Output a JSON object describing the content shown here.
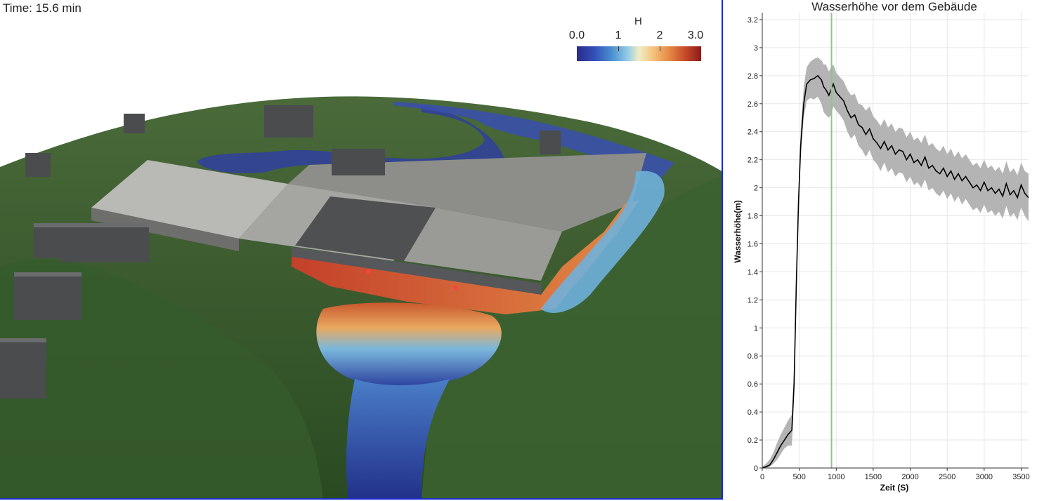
{
  "view": {
    "time_label": "Time: 15.6 min",
    "colorbar": {
      "title": "H",
      "ticks": [
        "0.0",
        "1",
        "2",
        "3.0"
      ],
      "range": [
        0.0,
        3.0
      ]
    }
  },
  "chart_data": {
    "type": "line",
    "title": "Wasserhöhe vor dem Gebäude",
    "xlabel": "Zeit (S)",
    "ylabel": "Wasserhöhe(m)",
    "xlim": [
      0,
      3600
    ],
    "ylim": [
      0,
      3.25
    ],
    "xticks": [
      0,
      500,
      1000,
      1500,
      2000,
      2500,
      3000,
      3500
    ],
    "yticks": [
      0,
      0.2,
      0.4,
      0.6,
      0.8,
      1,
      1.2,
      1.4,
      1.6,
      1.8,
      2,
      2.2,
      2.4,
      2.6,
      2.8,
      3,
      3.2
    ],
    "grid": true,
    "current_time": 936,
    "series": [
      {
        "kind": "line",
        "color": "#000000",
        "x": [
          0,
          50,
          100,
          150,
          200,
          250,
          300,
          350,
          400,
          430,
          460,
          490,
          520,
          560,
          600,
          650,
          700,
          750,
          800,
          830,
          860,
          900,
          930,
          960,
          1000,
          1050,
          1100,
          1150,
          1200,
          1250,
          1300,
          1350,
          1400,
          1450,
          1500,
          1550,
          1600,
          1650,
          1700,
          1750,
          1800,
          1850,
          1900,
          1950,
          2000,
          2050,
          2100,
          2150,
          2200,
          2250,
          2300,
          2350,
          2400,
          2450,
          2500,
          2550,
          2600,
          2650,
          2700,
          2750,
          2800,
          2850,
          2900,
          2950,
          3000,
          3050,
          3100,
          3150,
          3200,
          3250,
          3300,
          3350,
          3400,
          3450,
          3500,
          3550,
          3600
        ],
        "y": [
          0,
          0.01,
          0.02,
          0.06,
          0.11,
          0.16,
          0.2,
          0.24,
          0.27,
          0.6,
          1.3,
          1.9,
          2.3,
          2.6,
          2.74,
          2.77,
          2.78,
          2.8,
          2.77,
          2.72,
          2.7,
          2.66,
          2.7,
          2.74,
          2.68,
          2.65,
          2.62,
          2.55,
          2.5,
          2.52,
          2.45,
          2.43,
          2.38,
          2.42,
          2.35,
          2.32,
          2.28,
          2.33,
          2.27,
          2.3,
          2.24,
          2.27,
          2.26,
          2.2,
          2.24,
          2.18,
          2.2,
          2.16,
          2.22,
          2.14,
          2.16,
          2.12,
          2.1,
          2.14,
          2.08,
          2.12,
          2.06,
          2.1,
          2.05,
          2.08,
          2.04,
          2.0,
          2.02,
          1.98,
          2.04,
          1.98,
          2.0,
          1.96,
          1.99,
          1.94,
          2.03,
          1.95,
          1.98,
          1.93,
          2.02,
          1.96,
          1.93
        ]
      },
      {
        "kind": "band",
        "color": "#b4b4b4",
        "x": [
          0,
          50,
          100,
          150,
          200,
          250,
          300,
          350,
          400,
          430,
          460,
          490,
          520,
          560,
          600,
          650,
          700,
          750,
          800,
          830,
          860,
          900,
          930,
          960,
          1000,
          1050,
          1100,
          1150,
          1200,
          1250,
          1300,
          1350,
          1400,
          1450,
          1500,
          1550,
          1600,
          1650,
          1700,
          1750,
          1800,
          1850,
          1900,
          1950,
          2000,
          2050,
          2100,
          2150,
          2200,
          2250,
          2300,
          2350,
          2400,
          2450,
          2500,
          2550,
          2600,
          2650,
          2700,
          2750,
          2800,
          2850,
          2900,
          2950,
          3000,
          3050,
          3100,
          3150,
          3200,
          3250,
          3300,
          3350,
          3400,
          3450,
          3500,
          3550,
          3600
        ],
        "lower": [
          0,
          0.0,
          0.01,
          0.03,
          0.06,
          0.1,
          0.14,
          0.16,
          0.16,
          0.5,
          1.25,
          1.85,
          2.22,
          2.5,
          2.62,
          2.64,
          2.63,
          2.65,
          2.6,
          2.54,
          2.52,
          2.5,
          2.52,
          2.58,
          2.55,
          2.52,
          2.48,
          2.4,
          2.35,
          2.38,
          2.3,
          2.27,
          2.22,
          2.27,
          2.2,
          2.17,
          2.12,
          2.18,
          2.11,
          2.14,
          2.08,
          2.11,
          2.1,
          2.04,
          2.08,
          2.02,
          2.04,
          2.0,
          2.06,
          1.98,
          2.0,
          1.96,
          1.94,
          1.98,
          1.92,
          1.96,
          1.9,
          1.94,
          1.88,
          1.92,
          1.88,
          1.84,
          1.86,
          1.82,
          1.88,
          1.82,
          1.84,
          1.8,
          1.83,
          1.78,
          1.87,
          1.79,
          1.82,
          1.77,
          1.86,
          1.8,
          1.76
        ],
        "upper": [
          0.01,
          0.03,
          0.06,
          0.11,
          0.18,
          0.24,
          0.29,
          0.34,
          0.38,
          0.72,
          1.4,
          2.0,
          2.42,
          2.72,
          2.86,
          2.9,
          2.92,
          2.93,
          2.91,
          2.88,
          2.88,
          2.83,
          2.86,
          2.88,
          2.82,
          2.79,
          2.76,
          2.7,
          2.66,
          2.67,
          2.6,
          2.59,
          2.55,
          2.58,
          2.51,
          2.48,
          2.44,
          2.49,
          2.43,
          2.46,
          2.4,
          2.43,
          2.42,
          2.36,
          2.4,
          2.34,
          2.36,
          2.32,
          2.38,
          2.3,
          2.32,
          2.28,
          2.26,
          2.3,
          2.24,
          2.28,
          2.22,
          2.26,
          2.21,
          2.24,
          2.2,
          2.16,
          2.18,
          2.14,
          2.2,
          2.14,
          2.16,
          2.12,
          2.15,
          2.1,
          2.19,
          2.11,
          2.14,
          2.09,
          2.18,
          2.12,
          2.1
        ]
      }
    ]
  },
  "colors": {
    "border": "#1b2bd0",
    "grid": "#e6e6e6",
    "line": "#000000",
    "band": "#b4b4b4",
    "marker": "#7ed07e"
  }
}
